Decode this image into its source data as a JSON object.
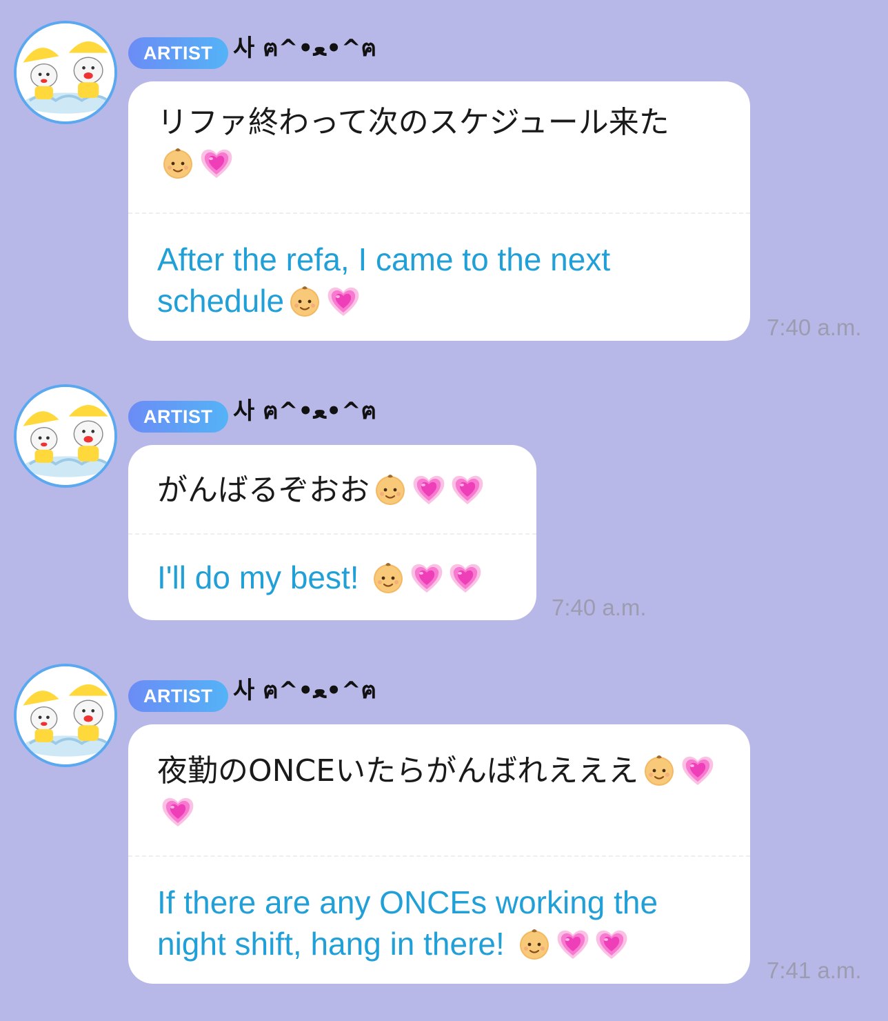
{
  "messages": [
    {
      "badge": "ARTIST",
      "sender": "사 ฅ^•ﻌ•^ฅ",
      "original": [
        "リファ終わって次のスケジュール来た",
        ""
      ],
      "translation": [
        "After the refa, I came to the next",
        "schedule"
      ],
      "time": "7:40 a.m."
    },
    {
      "badge": "ARTIST",
      "sender": "사 ฅ^•ﻌ•^ฅ",
      "original": [
        "がんばるぞおお"
      ],
      "translation": [
        "I'll do my best! "
      ],
      "time": "7:40 a.m."
    },
    {
      "badge": "ARTIST",
      "sender": "사 ฅ^•ﻌ•^ฅ",
      "original": [
        "夜勤のONCEいたらがんばれえええ",
        ""
      ],
      "translation": [
        "If there are any ONCEs working the",
        "night shift, hang in there! "
      ],
      "time": "7:41 a.m."
    }
  ],
  "icons": {
    "avatar": "cartoon-cat-avatar-icon",
    "baby": "baby-face-emoji-icon",
    "heart": "growing-pink-heart-emoji-icon"
  },
  "colors": {
    "background": "#b8b8e8",
    "translation_text": "#21a0d8",
    "badge_start": "#6b8cf5",
    "badge_end": "#54b3f7",
    "timestamp": "#9c9cb0"
  }
}
